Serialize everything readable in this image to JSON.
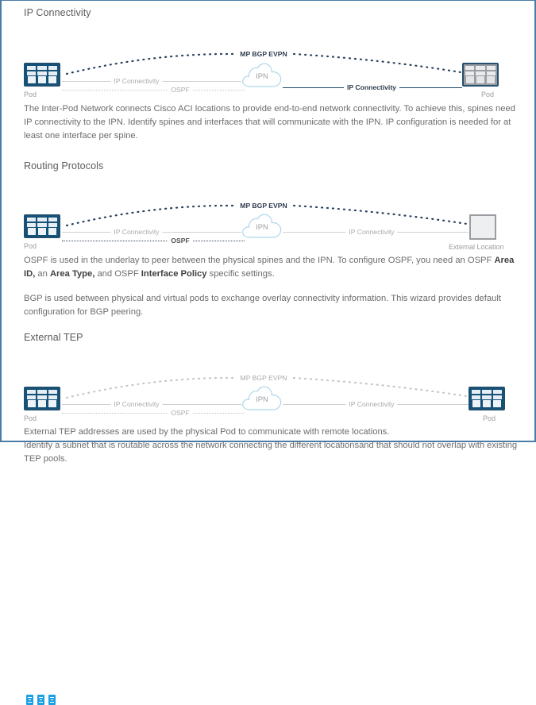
{
  "sections": [
    {
      "id": "ip-connectivity",
      "title": "IP Connectivity",
      "diagram": {
        "left_node_label": "Pod",
        "right_node_label": "Pod",
        "cloud_label": "IPN",
        "evpn_label": "MP BGP EVPN",
        "left_link_label": "IP Connectivity",
        "ospf_label": "OSPF",
        "right_link_label": "IP Connectivity"
      },
      "paragraphs": [
        "The Inter-Pod Network connects Cisco ACI locations to provide end-to-end network connectivity. To achieve this, spines need IP connectivity to the IPN. Identify spines and interfaces that will communicate with the IPN. IP configuration is needed for at least one interface per spine."
      ]
    },
    {
      "id": "routing-protocols",
      "title": "Routing Protocols",
      "diagram": {
        "left_node_label": "Pod",
        "right_node_label": "External Location",
        "cloud_label": "IPN",
        "evpn_label": "MP BGP EVPN",
        "left_link_label": "IP Connectivity",
        "ospf_label": "OSPF",
        "right_link_label": "IP Connectivity"
      },
      "paragraphs": [
        "OSPF is used in the underlay to peer between the physical spines and the IPN. To configure OSPF, you need an OSPF <b>Area ID,</b> an <b>Area Type,</b> and OSPF <b>Interface Policy</b> specific settings.",
        "BGP is used between physical and virtual pods to exchange overlay connectivity information. This wizard provides default configuration for BGP peering."
      ]
    },
    {
      "id": "external-tep",
      "title": "External TEP",
      "diagram": {
        "left_node_label": "Pod",
        "right_node_label": "Pod",
        "cloud_label": "IPN",
        "evpn_label": "MP BGP EVPN",
        "left_link_label": "IP Connectivity",
        "ospf_label": "OSPF",
        "right_link_label": "IP Connectivity"
      },
      "paragraphs": [
        "External TEP addresses are used by the physical Pod to communicate with remote locations.",
        "Identify a subnet that is routable across the network connecting the different locationsand that should not overlap with existing TEP pools."
      ]
    }
  ],
  "colors": {
    "border": "#4a7ca8",
    "pod_blue": "#14527a",
    "pod_gray": "#9a9da1",
    "cloud_blue": "#aed6ea",
    "link_gray": "#cdd0d3",
    "link_dark": "#1b4b6b",
    "evpn_dark": "#3a4a5e",
    "text_gray": "#6b6c6e",
    "vm_blue": "#1ba1e2"
  }
}
